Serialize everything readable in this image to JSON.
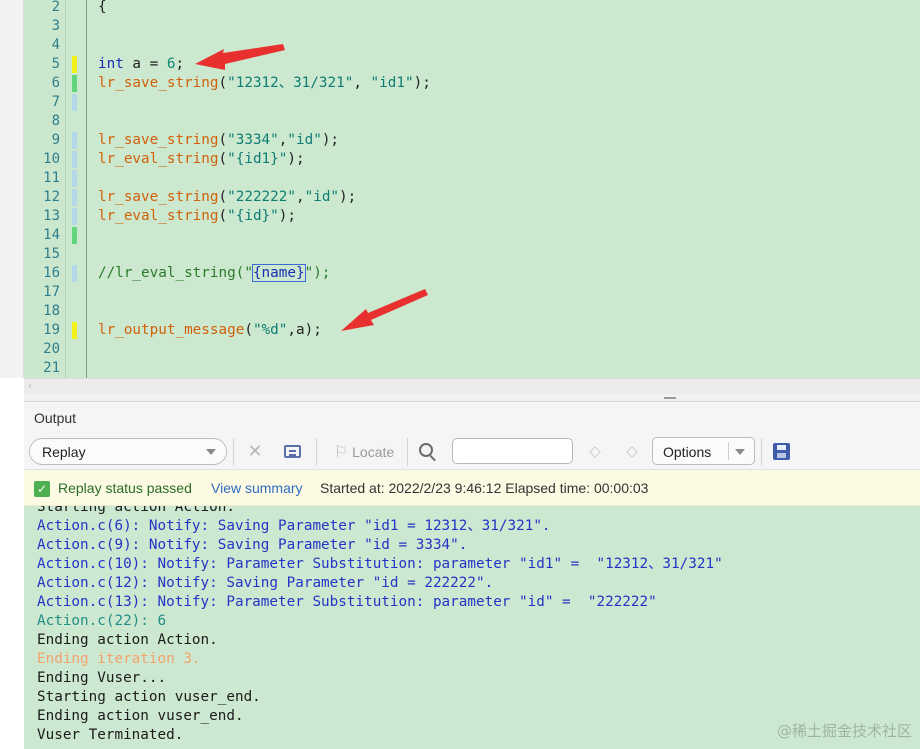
{
  "editor": {
    "lines": [
      {
        "num": "2",
        "marker": "",
        "tokens": [
          {
            "t": "{",
            "c": ""
          }
        ]
      },
      {
        "num": "3",
        "marker": "",
        "tokens": []
      },
      {
        "num": "4",
        "marker": "",
        "tokens": []
      },
      {
        "num": "5",
        "marker": "yellow",
        "tokens": [
          {
            "t": "int",
            "c": "kw"
          },
          {
            "t": " a = ",
            "c": ""
          },
          {
            "t": "6",
            "c": "num"
          },
          {
            "t": ";",
            "c": ""
          }
        ]
      },
      {
        "num": "6",
        "marker": "green",
        "tokens": [
          {
            "t": "lr_save_string",
            "c": "fn"
          },
          {
            "t": "(",
            "c": ""
          },
          {
            "t": "\"12312、31/321\"",
            "c": "str"
          },
          {
            "t": ", ",
            "c": ""
          },
          {
            "t": "\"id1\"",
            "c": "str"
          },
          {
            "t": ");",
            "c": ""
          }
        ]
      },
      {
        "num": "7",
        "marker": "blue",
        "tokens": []
      },
      {
        "num": "8",
        "marker": "",
        "tokens": []
      },
      {
        "num": "9",
        "marker": "blue",
        "tokens": [
          {
            "t": "lr_save_string",
            "c": "fn"
          },
          {
            "t": "(",
            "c": ""
          },
          {
            "t": "\"3334\"",
            "c": "str"
          },
          {
            "t": ",",
            "c": ""
          },
          {
            "t": "\"id\"",
            "c": "str"
          },
          {
            "t": ");",
            "c": ""
          }
        ]
      },
      {
        "num": "10",
        "marker": "blue",
        "tokens": [
          {
            "t": "lr_eval_string",
            "c": "fn"
          },
          {
            "t": "(",
            "c": ""
          },
          {
            "t": "\"{id1}\"",
            "c": "str"
          },
          {
            "t": ");",
            "c": ""
          }
        ]
      },
      {
        "num": "11",
        "marker": "blue",
        "tokens": []
      },
      {
        "num": "12",
        "marker": "blue",
        "tokens": [
          {
            "t": "lr_save_string",
            "c": "fn"
          },
          {
            "t": "(",
            "c": ""
          },
          {
            "t": "\"222222\"",
            "c": "str"
          },
          {
            "t": ",",
            "c": ""
          },
          {
            "t": "\"id\"",
            "c": "str"
          },
          {
            "t": ");",
            "c": ""
          }
        ]
      },
      {
        "num": "13",
        "marker": "blue",
        "tokens": [
          {
            "t": "lr_eval_string",
            "c": "fn"
          },
          {
            "t": "(",
            "c": ""
          },
          {
            "t": "\"{id}\"",
            "c": "str"
          },
          {
            "t": ");",
            "c": ""
          }
        ]
      },
      {
        "num": "14",
        "marker": "green",
        "tokens": []
      },
      {
        "num": "15",
        "marker": "",
        "tokens": []
      },
      {
        "num": "16",
        "marker": "blue",
        "tokens": [
          {
            "t": "//lr_eval_string(\"",
            "c": "cm"
          },
          {
            "t": "{name}",
            "c": "hl"
          },
          {
            "t": "\");",
            "c": "cm"
          }
        ]
      },
      {
        "num": "17",
        "marker": "",
        "tokens": []
      },
      {
        "num": "18",
        "marker": "",
        "tokens": []
      },
      {
        "num": "19",
        "marker": "yellow",
        "tokens": [
          {
            "t": "lr_output_message",
            "c": "fn"
          },
          {
            "t": "(",
            "c": ""
          },
          {
            "t": "\"%d\"",
            "c": "str"
          },
          {
            "t": ",a);",
            "c": ""
          }
        ]
      },
      {
        "num": "20",
        "marker": "",
        "tokens": []
      },
      {
        "num": "21",
        "marker": "",
        "tokens": []
      }
    ]
  },
  "scrollbar": {
    "left_arrow": "‹"
  },
  "output": {
    "title": "Output",
    "toolbar": {
      "mode": "Replay",
      "clear_icon": "✕",
      "locate_label": "Locate",
      "locate_icon": "⚐",
      "search_value": "",
      "prev_icon": "◇",
      "next_icon": "◇",
      "options_label": "Options"
    },
    "status": {
      "check": "✓",
      "text": "Replay status passed",
      "link": "View summary",
      "info": "Started at: 2022/2/23 9:46:12 Elapsed time: 00:00:03"
    },
    "log": [
      {
        "text": "Starting action Action.",
        "color": "black"
      },
      {
        "text": "Action.c(6): Notify: Saving Parameter \"id1 = 12312、31/321\".",
        "color": "blue"
      },
      {
        "text": "Action.c(9): Notify: Saving Parameter \"id = 3334\".",
        "color": "blue"
      },
      {
        "text": "Action.c(10): Notify: Parameter Substitution: parameter \"id1\" =  \"12312、31/321\"",
        "color": "blue"
      },
      {
        "text": "Action.c(12): Notify: Saving Parameter \"id = 222222\".",
        "color": "blue"
      },
      {
        "text": "Action.c(13): Notify: Parameter Substitution: parameter \"id\" =  \"222222\"",
        "color": "blue"
      },
      {
        "text": "Action.c(22): 6",
        "color": "teal"
      },
      {
        "text": "Ending action Action.",
        "color": "black"
      },
      {
        "text": "Ending iteration 3.",
        "color": "orange"
      },
      {
        "text": "Ending Vuser...",
        "color": "black"
      },
      {
        "text": "Starting action vuser_end.",
        "color": "black"
      },
      {
        "text": "Ending action vuser_end.",
        "color": "black"
      },
      {
        "text": "Vuser Terminated.",
        "color": "black"
      }
    ]
  },
  "watermark": "@稀土掘金技术社区",
  "colors": {
    "arrow": "#e8312f",
    "editor_bg": "#cce8cf",
    "log_bg": "#cde8d0"
  }
}
